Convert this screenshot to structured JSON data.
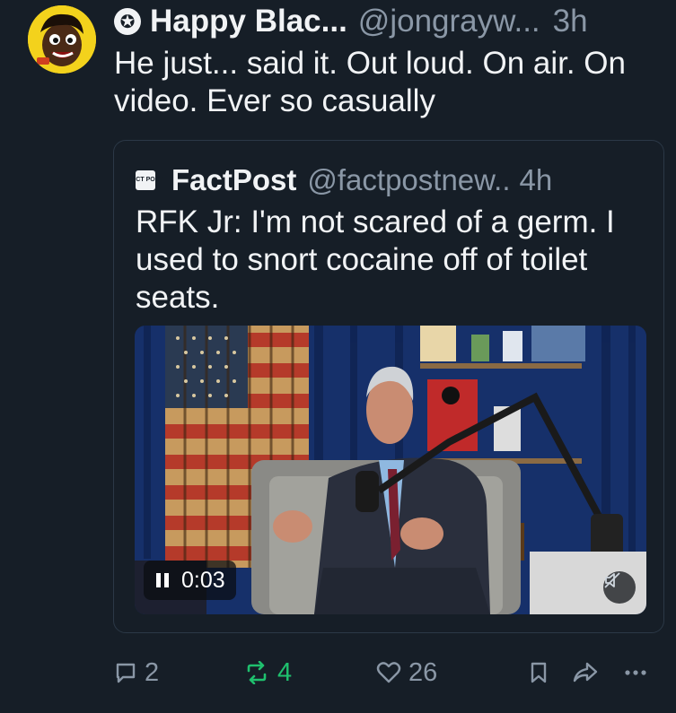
{
  "post": {
    "display_name": "Happy Blac...",
    "handle": "@jongrayw...",
    "time": "3h",
    "text": "He just... said it. Out loud. On air. On video. Ever so casually",
    "avatar_icon": "cartoon-avatar-icon",
    "badge_icon": "star-badge-icon"
  },
  "quote": {
    "avatar_text": "FACT POST",
    "display_name": "FactPost",
    "handle": "@factpostnew..",
    "time": "4h",
    "text": "RFK Jr: I'm not scared of a germ. I used to snort cocaine off of toilet seats.",
    "video": {
      "timestamp": "0:03",
      "state": "playing",
      "muted": true
    }
  },
  "actions": {
    "replies": "2",
    "reposts": "4",
    "likes": "26",
    "repost_color": "#1fc06e"
  },
  "colors": {
    "background": "#161e27",
    "text": "#f1f3f5",
    "muted": "#8a97a6",
    "border": "#2b3846"
  }
}
